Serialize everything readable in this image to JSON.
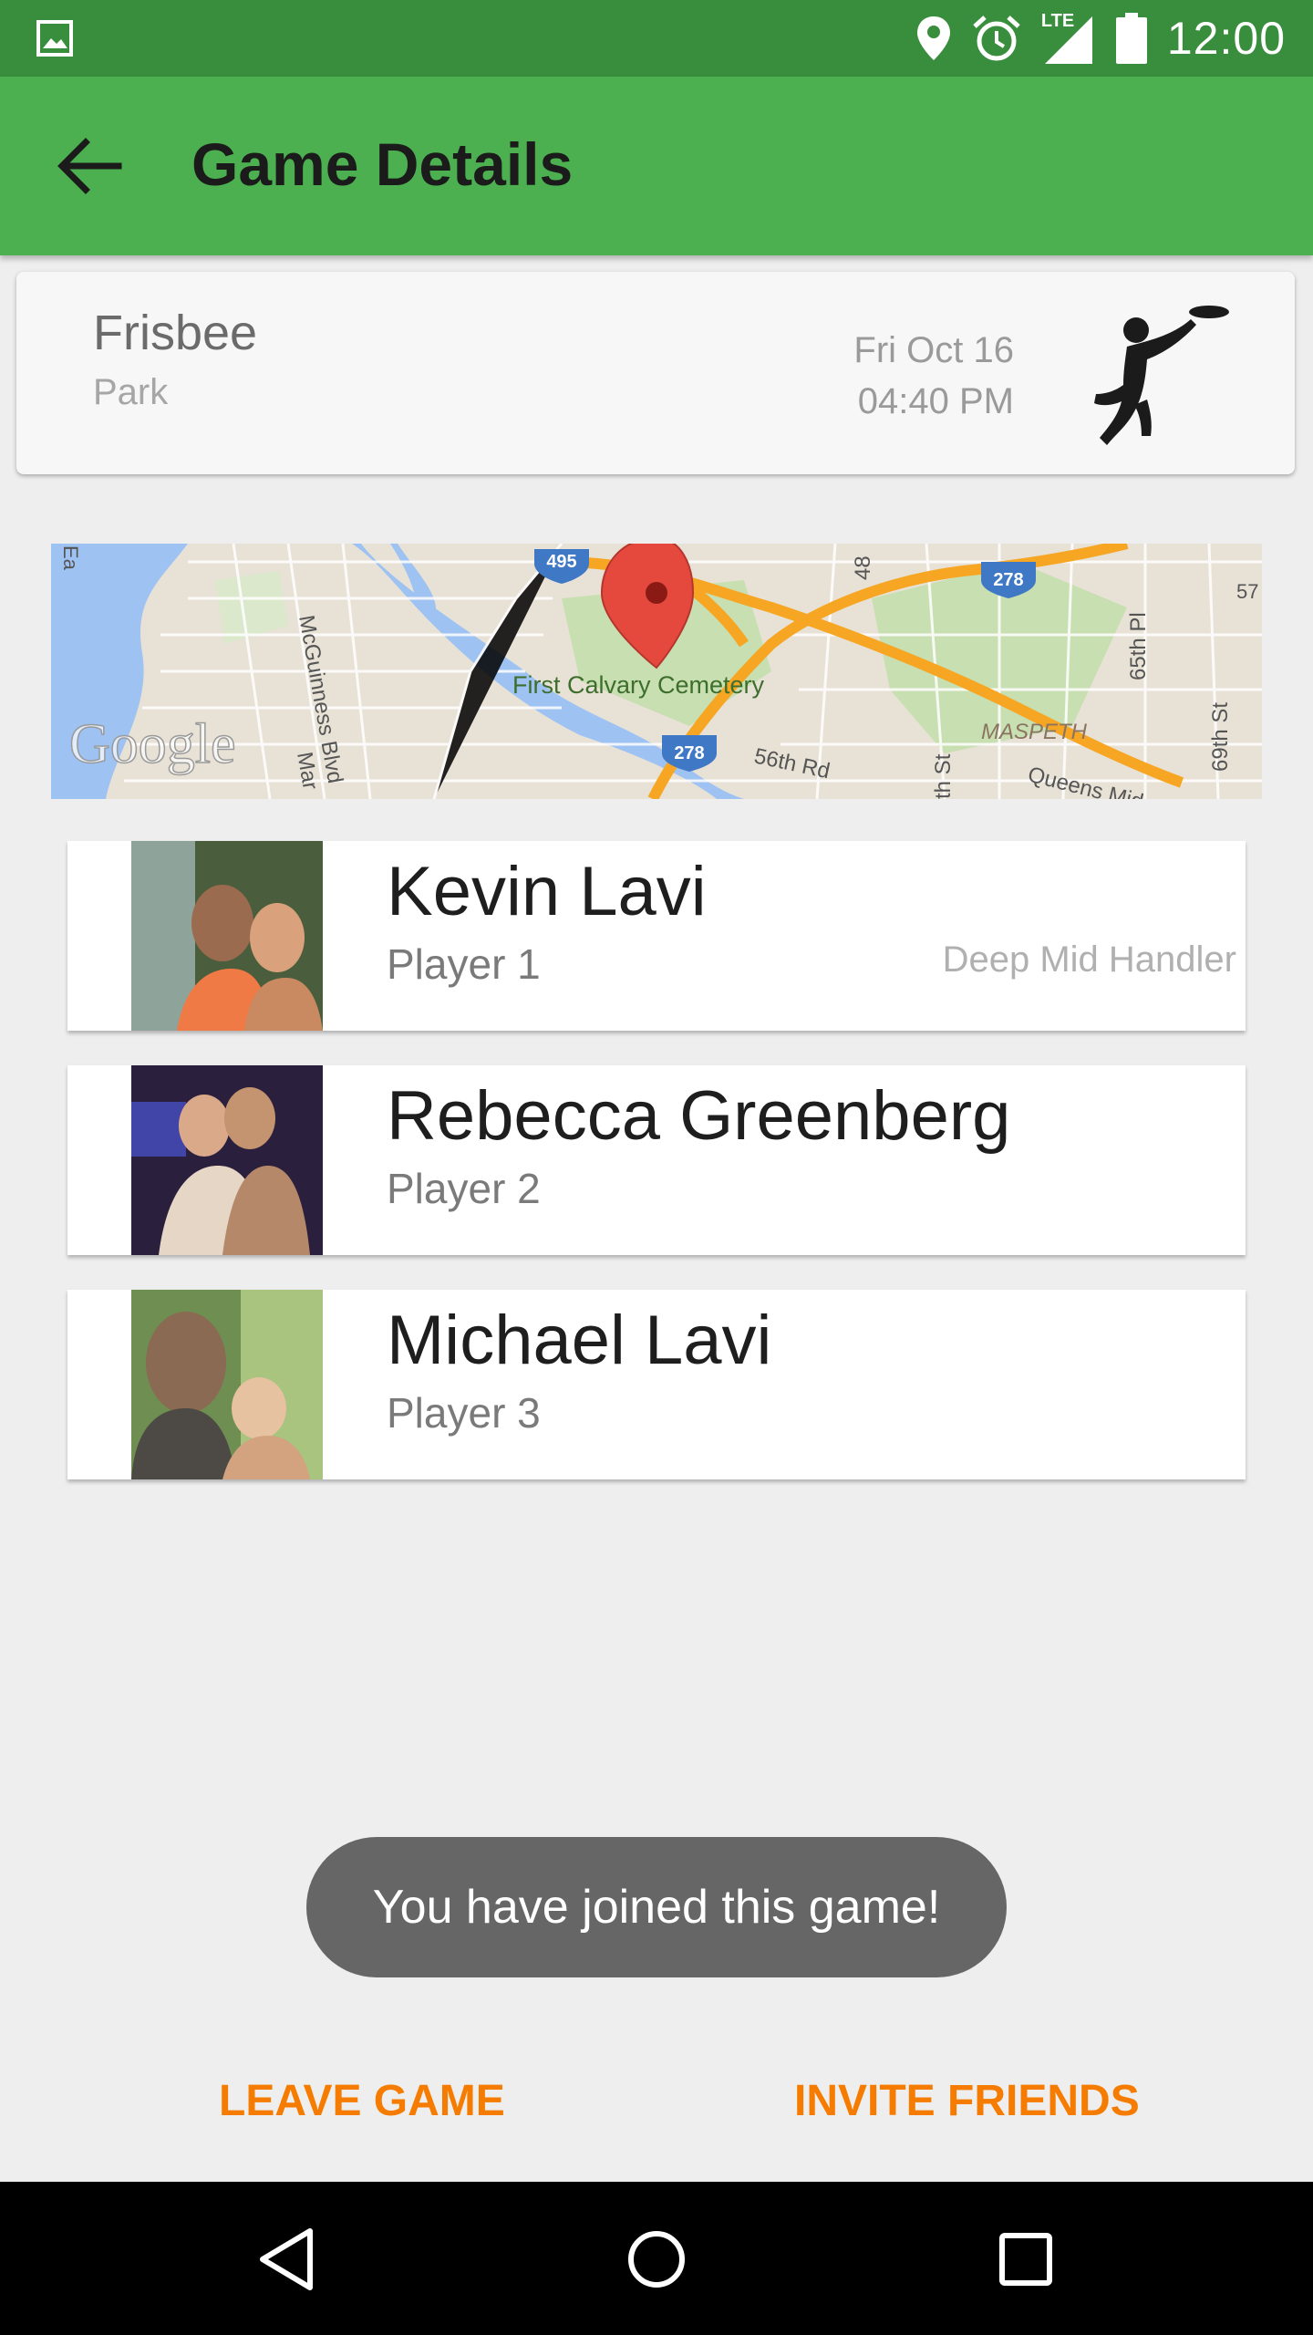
{
  "status_bar": {
    "time": "12:00",
    "network": "LTE",
    "icons": [
      "gallery-icon",
      "location-icon",
      "alarm-icon",
      "signal-icon",
      "battery-icon"
    ]
  },
  "app_bar": {
    "title": "Game Details",
    "back_icon": "arrow-left-icon"
  },
  "game": {
    "sport": "Frisbee",
    "venue": "Park",
    "date": "Fri Oct 16",
    "time": "04:40  PM",
    "sport_icon": "frisbee-player-icon"
  },
  "map": {
    "place_label": "First Calvary Cemetery",
    "area_label": "MASPETH",
    "street_labels": [
      "McGuinness Blvd",
      "56th Rd",
      "65th Pl",
      "69th St",
      "48",
      "Queens Mid",
      "Mar",
      "th St",
      "Ea",
      "57"
    ],
    "highway_shields": [
      "495",
      "278",
      "278"
    ],
    "watermark": "Google",
    "marker": "map-pin-icon"
  },
  "players": [
    {
      "name": "Kevin Lavi",
      "role": "Player 1",
      "position": "Deep Mid Handler"
    },
    {
      "name": "Rebecca Greenberg",
      "role": "Player 2",
      "position": ""
    },
    {
      "name": "Michael Lavi",
      "role": "Player 3",
      "position": ""
    }
  ],
  "toast": "You have joined this game!",
  "actions": {
    "leave": "LEAVE GAME",
    "invite": "INVITE FRIENDS"
  },
  "nav_bar": [
    "back-triangle-icon",
    "home-circle-icon",
    "recents-square-icon"
  ],
  "colors": {
    "primary": "#4caf50",
    "primary_dark": "#388e3c",
    "accent": "#f57c00",
    "toast_bg": "#666666"
  }
}
